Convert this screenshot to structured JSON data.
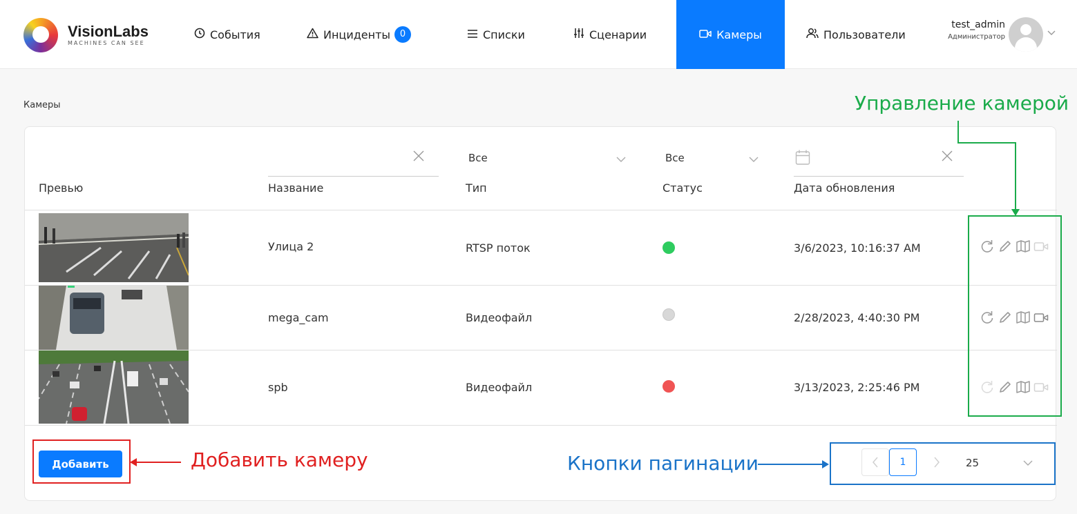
{
  "header": {
    "logo": {
      "name": "VisionLabs",
      "tagline": "MACHINES CAN SEE"
    },
    "nav": [
      {
        "label": "События",
        "icon": "clock-icon"
      },
      {
        "label": "Инциденты",
        "icon": "warning-icon",
        "badge": "0"
      },
      {
        "label": "Списки",
        "icon": "list-icon"
      },
      {
        "label": "Сценарии",
        "icon": "sliders-icon"
      },
      {
        "label": "Камеры",
        "icon": "camera-icon",
        "active": true
      },
      {
        "label": "Пользователи",
        "icon": "users-icon"
      }
    ],
    "user": {
      "name": "test_admin",
      "role": "Администратор"
    }
  },
  "breadcrumb": "Камеры",
  "table": {
    "filters": {
      "type_value": "Все",
      "status_value": "Все"
    },
    "columns": [
      "Превью",
      "Название",
      "Тип",
      "Статус",
      "Дата обновления"
    ],
    "rows": [
      {
        "name": "Улица 2",
        "type": "RTSP поток",
        "status": "active",
        "status_color": "#2ecc5f",
        "updated": "3/6/2023, 10:16:37 AM"
      },
      {
        "name": "mega_cam",
        "type": "Видеофайл",
        "status": "inactive",
        "status_color": "#d8d8d8",
        "updated": "2/28/2023, 4:40:30 PM"
      },
      {
        "name": "spb",
        "type": "Видеофайл",
        "status": "error",
        "status_color": "#f05454",
        "updated": "3/13/2023, 2:25:46 PM"
      }
    ]
  },
  "add_button": "Добавить",
  "pagination": {
    "current_page": "1",
    "page_size": "25"
  },
  "annotations": {
    "camera_control": "Управление камерой",
    "add_camera": "Добавить камеру",
    "pagination_buttons": "Кнопки пагинации"
  },
  "colors": {
    "accent": "#0a7bff",
    "annotation_green": "#1aab4a",
    "annotation_red": "#e02020",
    "annotation_blue": "#1a73c8"
  }
}
